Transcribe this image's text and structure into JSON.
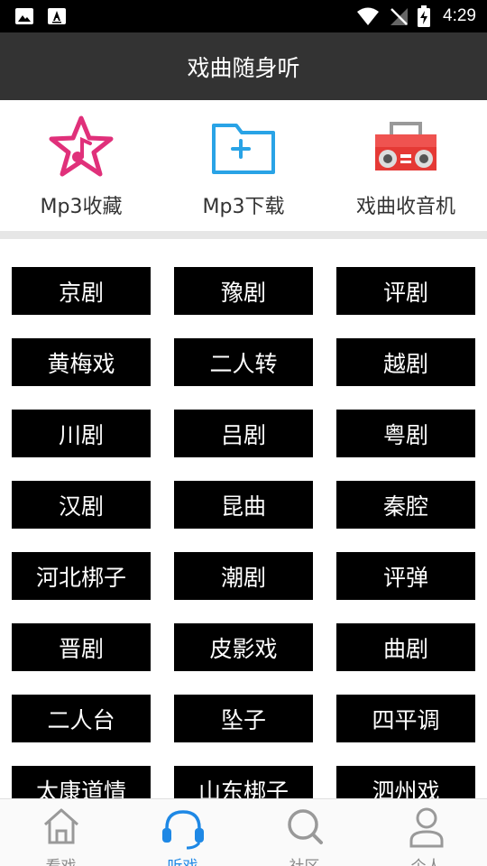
{
  "status_bar": {
    "time": "4:29"
  },
  "header": {
    "title": "戏曲随身听"
  },
  "quick_actions": [
    {
      "label": "Mp3收藏",
      "icon": "star-music-icon"
    },
    {
      "label": "Mp3下载",
      "icon": "folder-add-icon"
    },
    {
      "label": "戏曲收音机",
      "icon": "radio-icon"
    }
  ],
  "genres": [
    "京剧",
    "豫剧",
    "评剧",
    "黄梅戏",
    "二人转",
    "越剧",
    "川剧",
    "吕剧",
    "粤剧",
    "汉剧",
    "昆曲",
    "秦腔",
    "河北梆子",
    "潮剧",
    "评弹",
    "晋剧",
    "皮影戏",
    "曲剧",
    "二人台",
    "坠子",
    "四平调",
    "太康道情",
    "山东梆子",
    "泗州戏"
  ],
  "bottom_nav": [
    {
      "label": "看戏",
      "icon": "home-icon",
      "active": false
    },
    {
      "label": "听戏",
      "icon": "headset-icon",
      "active": true
    },
    {
      "label": "社区",
      "icon": "search-icon",
      "active": false
    },
    {
      "label": "个人",
      "icon": "person-icon",
      "active": false
    }
  ],
  "colors": {
    "accent": "#1e88e5",
    "header_bg": "#333333",
    "tile_bg": "#000000",
    "star_pink": "#e0307a",
    "folder_blue": "#29a3e6",
    "radio_red": "#e53935"
  }
}
